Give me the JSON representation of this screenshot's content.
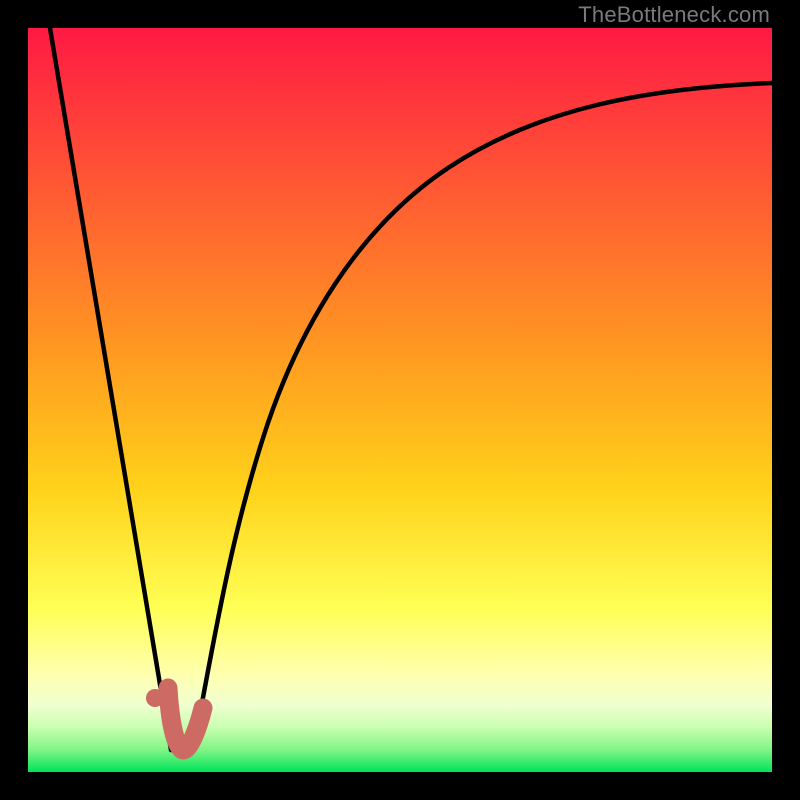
{
  "watermark": "TheBottleneck.com",
  "colors": {
    "gradient_top": "#ff1a44",
    "gradient_mid1": "#ff6a2a",
    "gradient_mid2": "#ffd21a",
    "gradient_mid3": "#ffff55",
    "gradient_low1": "#f6ffcf",
    "gradient_low2": "#b8ff96",
    "gradient_bottom": "#00e35a",
    "curve": "#000000",
    "marker": "#cc6a63",
    "background": "#000000"
  },
  "chart_data": {
    "type": "line",
    "title": "",
    "xlabel": "",
    "ylabel": "",
    "xlim": [
      0,
      100
    ],
    "ylim": [
      0,
      100
    ],
    "series": [
      {
        "name": "left-falling-line",
        "x": [
          3,
          19
        ],
        "values": [
          100,
          3
        ]
      },
      {
        "name": "right-rising-curve",
        "x": [
          22,
          26,
          30,
          36,
          44,
          54,
          66,
          80,
          100
        ],
        "values": [
          3,
          20,
          35,
          50,
          63,
          73,
          81,
          86,
          90
        ]
      },
      {
        "name": "marker-dot",
        "x": [
          17
        ],
        "values": [
          10
        ]
      },
      {
        "name": "marker-hook",
        "x": [
          19,
          20,
          23
        ],
        "values": [
          9,
          3,
          8
        ]
      }
    ],
    "legend": false,
    "grid": false
  }
}
